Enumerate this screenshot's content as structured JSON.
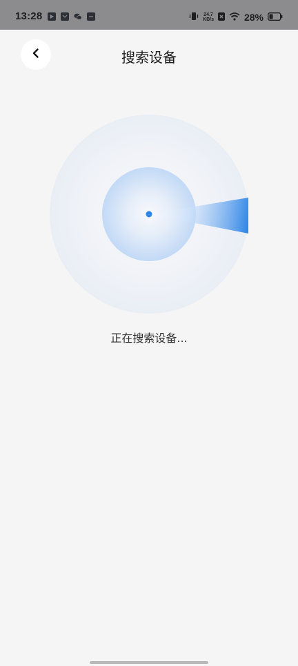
{
  "status_bar": {
    "time": "13:28",
    "net_speed_value": "24.7",
    "net_speed_unit": "KB/s",
    "battery_percent": "28%"
  },
  "header": {
    "title": "搜索设备"
  },
  "main": {
    "status_text": "正在搜索设备..."
  },
  "colors": {
    "background": "#f5f5f5",
    "accent": "#2f86e6",
    "status_bar": "#8c8c8f"
  }
}
